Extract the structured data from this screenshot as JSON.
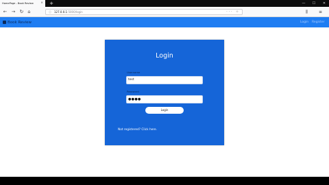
{
  "browser": {
    "tab_title": "HomePage - Book Review",
    "tab_close": "×",
    "new_tab": "+",
    "url_info_icon": "ⓘ",
    "url_host": "127.0.0.1",
    "url_path": ":5000/login",
    "url_actions_icons": "··· ☆",
    "back_icon": "←",
    "forward_icon": "→",
    "reload_icon": "↻",
    "home_icon": "⌂",
    "library_icon": "⫼",
    "menu_icon": "≡",
    "window_minimize": "—",
    "window_maximize": "☐",
    "window_close": "✕"
  },
  "appnav": {
    "brand": "Book Review",
    "links": [
      "Login",
      "Register"
    ]
  },
  "login_form": {
    "title": "Login",
    "username_label": "Username",
    "username_value": "test",
    "password_label": "Password",
    "password_value": "●●●●",
    "submit_label": "Login",
    "register_link": "Not registered? Click here."
  },
  "colors": {
    "nav_bg": "#1f7df2",
    "card_bg": "#1565d8",
    "tabbar_bg": "#0c0c0d"
  }
}
